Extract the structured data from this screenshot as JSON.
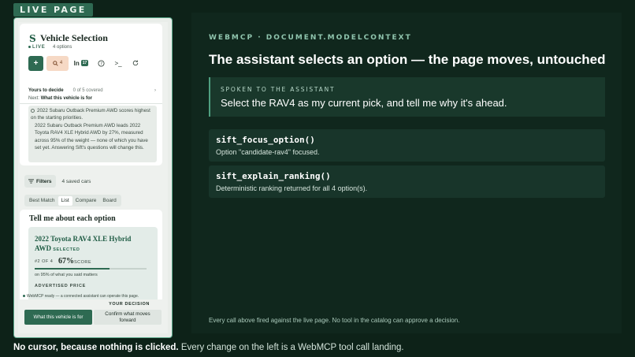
{
  "live_tag": "LIVE PAGE",
  "app": {
    "title": "Vehicle Selection",
    "live_label": "LIVE",
    "options_count": "4 options",
    "compare_count": "4",
    "in_label": "In",
    "in_count": "17",
    "decide_label": "Yours to decide",
    "covered": "0 of 5 covered",
    "next_label": "Next:",
    "next_value": "What this vehicle is for",
    "score_line_1": "2022 Subaru Outback Premium AWD scores highest on the starting priorities.",
    "score_line_2": "2022 Subaru Outback Premium AWD leads 2022 Toyota RAV4 XLE Hybrid AWD by 27%, measured across 95% of the weight — none of which you have set yet. Answering Sift's questions will change this.",
    "filters_label": "Filters",
    "saved_cars": "4 saved cars",
    "tabs": [
      "Best Match",
      "List",
      "Compare",
      "Board"
    ],
    "option_card_title": "Tell me about each option",
    "selected_car": "2022 Toyota RAV4 XLE Hybrid AWD",
    "selected_badge": "SELECTED",
    "rank_text": "#2 OF 4",
    "score_pct": "67%",
    "score_word": "SCORE",
    "score_fraction": 0.67,
    "match_note": "on 95% of what you said matters",
    "advertised_price_label": "ADVERTISED PRICE",
    "ready_text": "WebMCP ready — a connected assistant can operate this page.",
    "your_decision_label": "YOUR DECISION",
    "primary_button": "What this vehicle is for",
    "secondary_button": "Confirm what moves forward"
  },
  "panel": {
    "eyebrow": "WEBMCP · DOCUMENT.MODELCONTEXT",
    "headline": "The assistant selects an option — the page moves, untouched",
    "spoken_label": "SPOKEN TO THE ASSISTANT",
    "spoken_text": "Select the RAV4 as my current pick, and tell me why it's ahead.",
    "calls": [
      {
        "fn": "sift_focus_option()",
        "result": "Option \"candidate-rav4\" focused."
      },
      {
        "fn": "sift_explain_ranking()",
        "result": "Deterministic ranking returned for all 4 option(s)."
      }
    ],
    "footnote": "Every call above fired against the live page. No tool in the catalog can approve a decision."
  },
  "caption": {
    "bold": "No cursor, because nothing is clicked.",
    "rest": " Every change on the left is a WebMCP tool call landing."
  },
  "colors": {
    "background": "#0d2218",
    "panel": "#10271d",
    "accent": "#2e6a52",
    "accent_light": "#5aa88a"
  }
}
